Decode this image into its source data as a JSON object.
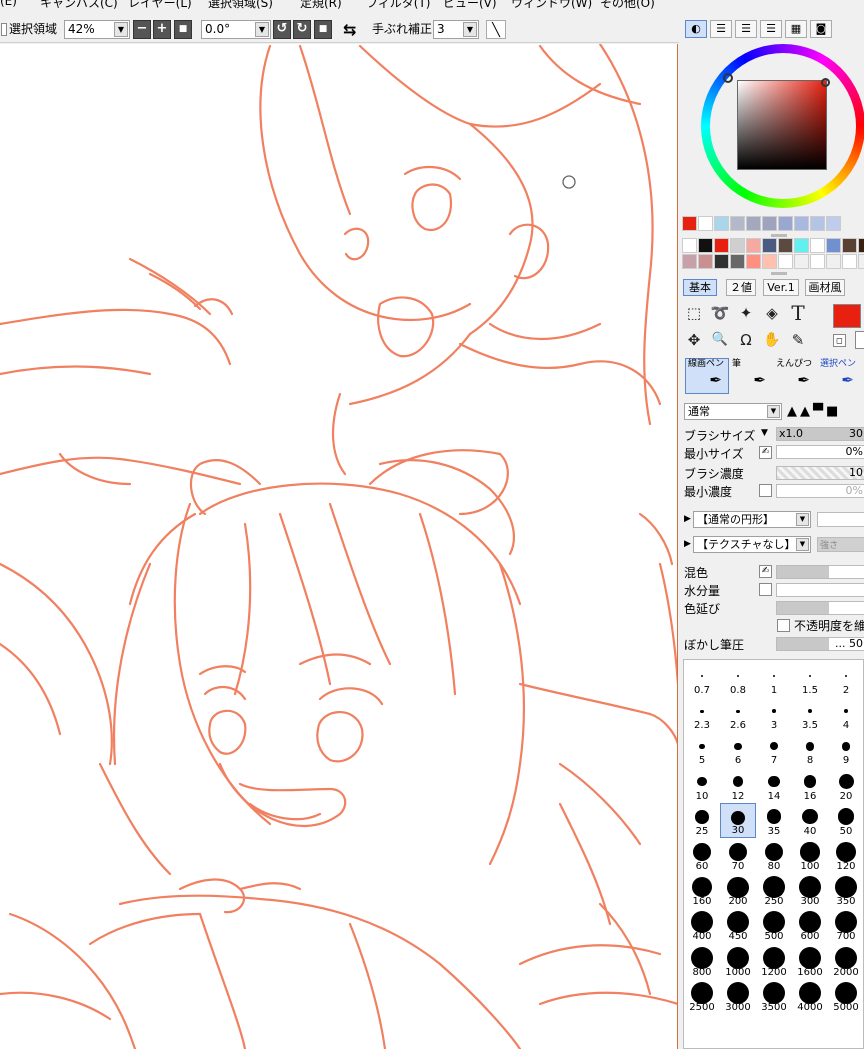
{
  "menu": [
    "(E)",
    "キャンバス(C)",
    "レイヤー(L)",
    "選択領域(S)",
    "定規(R)",
    "フィルタ(T)",
    "ビュー(V)",
    "ウィンドウ(W)",
    "その他(O)"
  ],
  "toolbar": {
    "selection_label": "選択領域",
    "zoom_value": "42%",
    "rotation_value": "0.0°",
    "stabilizer_label": "手ぶれ補正",
    "stabilizer_value": "3"
  },
  "icons": {
    "minus": "−",
    "plus": "+",
    "square": "■",
    "rotate_ccw": "↺",
    "rotate_cw": "↻",
    "flip": "⇆",
    "pen_line": "╲",
    "dropdown": "▼",
    "cursor_ring": "○"
  },
  "colors": {
    "lineart": "#f08060",
    "current_color": "#e82010",
    "accent": "#5d88c5",
    "palette_row1": [
      "#e82010",
      "#ffffff",
      "#a9d6ea",
      "#b4b9c9",
      "#a4a8bc",
      "#9ea4c0",
      "#9aa8d0",
      "#a8b8e0",
      "#b4c4e4",
      "#c0ccec"
    ],
    "palette_row2": [
      "#ffffff",
      "#111111",
      "#e82010",
      "#cfcfcf",
      "#f5a9a0",
      "#4a5a80",
      "#5a4a40",
      "#60f0f0",
      "#ffffff",
      "#7090d0",
      "#5a4030",
      "#3a2010"
    ],
    "palette_row3": [
      "#c8a0a8",
      "#c89090",
      "#303030",
      "#686868",
      "#ff9080",
      "#ffc0b0",
      "#ffffff",
      "#f0f0f0",
      "#ffffff",
      "#f0f0f0",
      "#ffffff",
      "#f0f0f0"
    ]
  },
  "panel": {
    "material_tabs": [
      "基本",
      "２値",
      "Ver.1",
      "画材風"
    ],
    "tools": {
      "text_icon": "T",
      "move_icon": "✥",
      "zoom_icon": "🔍",
      "rotate_icon": "Ω",
      "hand_icon": "✋",
      "eyedropper_icon": "✎",
      "select_rect_icon": "⬚",
      "lasso_icon": "➰",
      "wand_icon": "✦",
      "fill_icon": "◈"
    },
    "brush_types": [
      "線画ペン",
      "筆",
      "えんぴつ",
      "選択ペン"
    ],
    "blend_mode": "通常",
    "brush_size_label": "ブラシサイズ",
    "brush_size_mult": "x1.0",
    "brush_size_value": "30",
    "min_size_label": "最小サイズ",
    "min_size_value": "0%",
    "brush_density_label": "ブラシ濃度",
    "brush_density_value": "10",
    "min_density_label": "最小濃度",
    "min_density_value": "0%",
    "shape_select": "【通常の円形】",
    "texture_select": "【テクスチャなし】",
    "texture_extra": "強さ",
    "mix_label": "混色",
    "water_label": "水分量",
    "color_stretch_label": "色延び",
    "keep_opacity_label": "不透明度を維",
    "blur_pressure_label": "ぼかし筆圧",
    "blur_pressure_value": "... 50",
    "brush_sizes": [
      "0.7",
      "0.8",
      "1",
      "1.5",
      "2",
      "2.3",
      "2.6",
      "3",
      "3.5",
      "4",
      "5",
      "6",
      "7",
      "8",
      "9",
      "10",
      "12",
      "14",
      "16",
      "20",
      "25",
      "30",
      "35",
      "40",
      "50",
      "60",
      "70",
      "80",
      "100",
      "120",
      "160",
      "200",
      "250",
      "300",
      "350",
      "400",
      "450",
      "500",
      "600",
      "700",
      "800",
      "1000",
      "1200",
      "1600",
      "2000",
      "2500",
      "3000",
      "3500",
      "4000",
      "5000"
    ],
    "selected_brush_size": "30"
  }
}
